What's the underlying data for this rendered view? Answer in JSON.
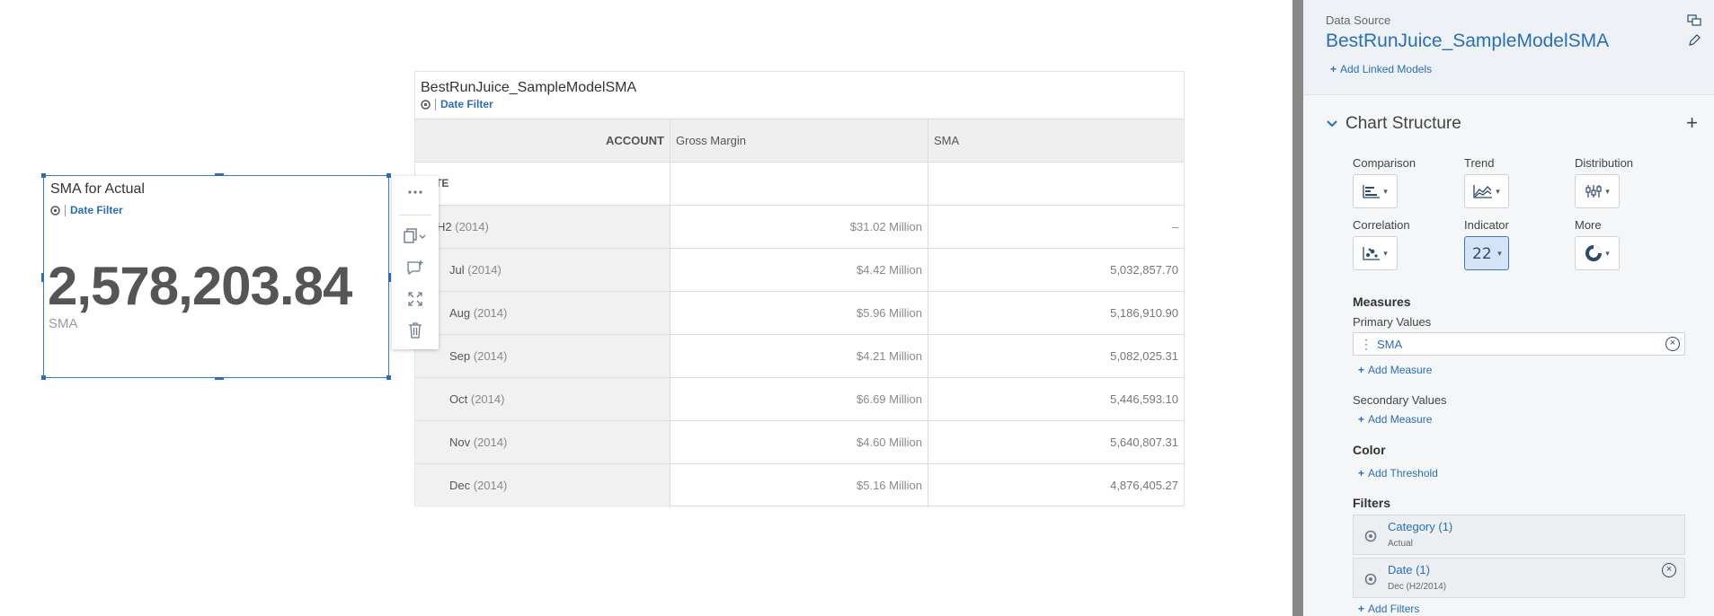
{
  "kpi": {
    "title": "SMA for Actual",
    "filter_label": "Date Filter",
    "value": "2,578,203.84",
    "measure": "SMA"
  },
  "table": {
    "title": "BestRunJuice_SampleModelSMA",
    "filter_label": "Date Filter",
    "header": {
      "account": "ACCOUNT",
      "col1": "Gross Margin",
      "col2": "SMA"
    },
    "date_label": "TE",
    "rows": [
      {
        "period": "H2",
        "year": "(2014)",
        "gross_margin": "$31.02 Million",
        "sma": "–"
      },
      {
        "period": "Jul",
        "year": "(2014)",
        "gross_margin": "$4.42 Million",
        "sma": "5,032,857.70"
      },
      {
        "period": "Aug",
        "year": "(2014)",
        "gross_margin": "$5.96 Million",
        "sma": "5,186,910.90"
      },
      {
        "period": "Sep",
        "year": "(2014)",
        "gross_margin": "$4.21 Million",
        "sma": "5,082,025.31"
      },
      {
        "period": "Oct",
        "year": "(2014)",
        "gross_margin": "$6.69 Million",
        "sma": "5,446,593.10"
      },
      {
        "period": "Nov",
        "year": "(2014)",
        "gross_margin": "$4.60 Million",
        "sma": "5,640,807.31"
      },
      {
        "period": "Dec",
        "year": "(2014)",
        "gross_margin": "$5.16 Million",
        "sma": "4,876,405.27"
      }
    ]
  },
  "panel": {
    "data_source_label": "Data Source",
    "data_source_name": "BestRunJuice_SampleModelSMA",
    "add_linked_models": "Add Linked Models",
    "chart_structure_title": "Chart Structure",
    "types": {
      "comparison": "Comparison",
      "trend": "Trend",
      "distribution": "Distribution",
      "correlation": "Correlation",
      "indicator": "Indicator",
      "more": "More"
    },
    "measures_title": "Measures",
    "primary_values_title": "Primary Values",
    "primary_value": "SMA",
    "add_measure": "Add Measure",
    "secondary_values_title": "Secondary Values",
    "add_measure_2": "Add Measure",
    "color_title": "Color",
    "add_threshold": "Add Threshold",
    "filters_title": "Filters",
    "filters": [
      {
        "name": "Category (1)",
        "value": "Actual"
      },
      {
        "name": "Date (1)",
        "value": "Dec (H2/2014)"
      }
    ],
    "add_filters": "Add Filters"
  }
}
